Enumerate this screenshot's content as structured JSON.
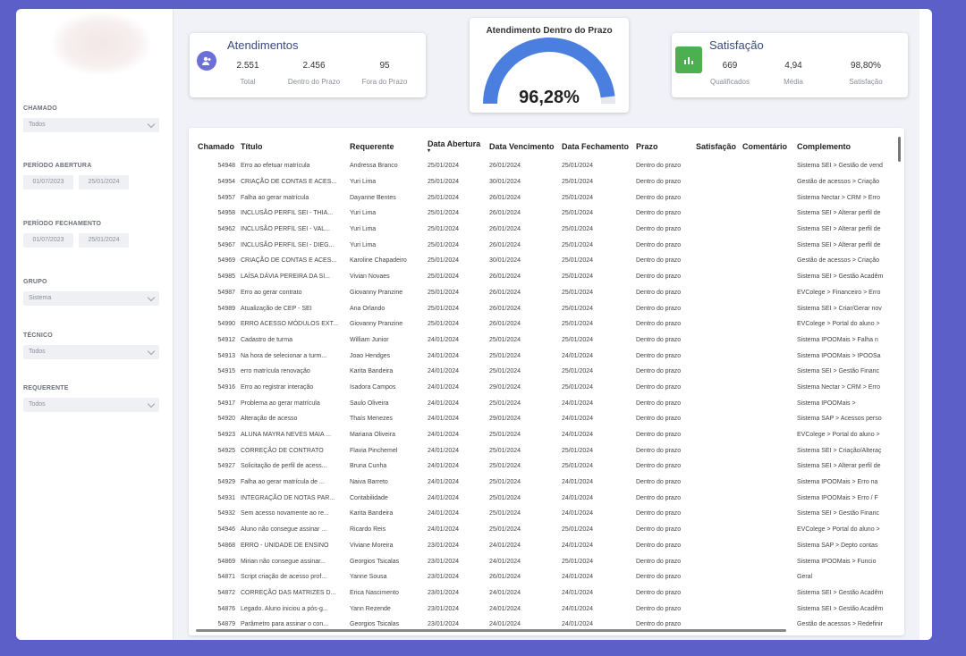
{
  "filters": {
    "chamado": {
      "label": "CHAMADO",
      "value": "Todos"
    },
    "periodo_abertura": {
      "label": "PERÍODO ABERTURA",
      "from": "01/07/2023",
      "to": "25/01/2024"
    },
    "periodo_fechamento": {
      "label": "PERÍODO FECHAMENTO",
      "from": "01/07/2023",
      "to": "25/01/2024"
    },
    "grupo": {
      "label": "GRUPO",
      "value": "Sistema"
    },
    "tecnico": {
      "label": "TÉCNICO",
      "value": "Todos"
    },
    "requerente": {
      "label": "REQUERENTE",
      "value": "Todos"
    }
  },
  "atendimentos": {
    "title": "Atendimentos",
    "icon": "users-icon",
    "color": "#6b6fd8",
    "stats": [
      {
        "value": "2.551",
        "label": "Total"
      },
      {
        "value": "2.456",
        "label": "Dentro do Prazo"
      },
      {
        "value": "95",
        "label": "Fora do Prazo"
      }
    ]
  },
  "gauge": {
    "title": "Atendimento Dentro do Prazo",
    "value_text": "96,28%",
    "value": 96.28,
    "color": "#4a7fe0"
  },
  "satisfacao": {
    "title": "Satisfação",
    "icon": "chart-icon",
    "color": "#4caf50",
    "stats": [
      {
        "value": "669",
        "label": "Qualificados"
      },
      {
        "value": "4,94",
        "label": "Média"
      },
      {
        "value": "98,80%",
        "label": "Satisfação"
      }
    ]
  },
  "table": {
    "columns": [
      "Chamado",
      "Título",
      "Requerente",
      "Data Abertura",
      "Data Vencimento",
      "Data Fechamento",
      "Prazo",
      "Satisfação",
      "Comentário",
      "Complemento"
    ],
    "rows": [
      [
        "54948",
        "Erro ao efetuar matrícula",
        "Andressa Branco",
        "25/01/2024",
        "26/01/2024",
        "25/01/2024",
        "Dentro do prazo",
        "",
        "",
        "Sistema SEI > Gestão de vend"
      ],
      [
        "54954",
        "CRIAÇÃO DE CONTAS E ACES...",
        "Yuri Lima",
        "25/01/2024",
        "30/01/2024",
        "25/01/2024",
        "Dentro do prazo",
        "",
        "",
        "Gestão de acessos > Criação"
      ],
      [
        "54957",
        "Falha ao gerar matrícula",
        "Dayanne Bentes",
        "25/01/2024",
        "26/01/2024",
        "25/01/2024",
        "Dentro do prazo",
        "",
        "",
        "Sistema Nectar > CRM > Erro"
      ],
      [
        "54958",
        "INCLUSÃO PERFIL SEI - THIA...",
        "Yuri Lima",
        "25/01/2024",
        "26/01/2024",
        "25/01/2024",
        "Dentro do prazo",
        "",
        "",
        "Sistema SEI > Alterar perfil de"
      ],
      [
        "54962",
        "INCLUSÃO PERFIL SEI - VAL...",
        "Yuri Lima",
        "25/01/2024",
        "26/01/2024",
        "25/01/2024",
        "Dentro do prazo",
        "",
        "",
        "Sistema SEI > Alterar perfil de"
      ],
      [
        "54967",
        "INCLUSÃO PERFIL SEI - DIEG...",
        "Yuri Lima",
        "25/01/2024",
        "26/01/2024",
        "25/01/2024",
        "Dentro do prazo",
        "",
        "",
        "Sistema SEI > Alterar perfil de"
      ],
      [
        "54969",
        "CRIAÇÃO DE CONTAS E ACES...",
        "Karoline Chapadeiro",
        "25/01/2024",
        "30/01/2024",
        "25/01/2024",
        "Dentro do prazo",
        "",
        "",
        "Gestão de acessos > Criação"
      ],
      [
        "54985",
        "LAÍSA DÁVIA PEREIRA DA SI...",
        "Vivian Novaes",
        "25/01/2024",
        "26/01/2024",
        "25/01/2024",
        "Dentro do prazo",
        "",
        "",
        "Sistema SEI > Gestão Acadêm"
      ],
      [
        "54987",
        "Erro ao gerar contrato",
        "Giovanny Pranzine",
        "25/01/2024",
        "26/01/2024",
        "25/01/2024",
        "Dentro do prazo",
        "",
        "",
        "EVColege > Financeiro > Erro"
      ],
      [
        "54989",
        "Atualização de CEP - SEI",
        "Ana Orlando",
        "25/01/2024",
        "26/01/2024",
        "25/01/2024",
        "Dentro do prazo",
        "",
        "",
        "Sistema SEI > Criar/Gerar nov"
      ],
      [
        "54990",
        "ERRO ACESSO MÓDULOS EXT...",
        "Giovanny Pranzine",
        "25/01/2024",
        "26/01/2024",
        "25/01/2024",
        "Dentro do prazo",
        "",
        "",
        "EVColege > Portal do aluno >"
      ],
      [
        "54912",
        "Cadastro de turma",
        "William Junior",
        "24/01/2024",
        "25/01/2024",
        "25/01/2024",
        "Dentro do prazo",
        "",
        "",
        "Sistema IPOOMais > Falha n"
      ],
      [
        "54913",
        "Na hora de selecionar a turm...",
        "Joao Hendges",
        "24/01/2024",
        "25/01/2024",
        "24/01/2024",
        "Dentro do prazo",
        "",
        "",
        "Sistema IPOOMais > IPOOSa"
      ],
      [
        "54915",
        "erro matrícula renovação",
        "Karita Bandeira",
        "24/01/2024",
        "25/01/2024",
        "25/01/2024",
        "Dentro do prazo",
        "",
        "",
        "Sistema SEI > Gestão Financ"
      ],
      [
        "54916",
        "Erro ao registrar interação",
        "Isadora Campos",
        "24/01/2024",
        "29/01/2024",
        "25/01/2024",
        "Dentro do prazo",
        "",
        "",
        "Sistema Nectar > CRM > Erro"
      ],
      [
        "54917",
        "Problema ao gerar matrícula",
        "Saulo Oliveira",
        "24/01/2024",
        "25/01/2024",
        "24/01/2024",
        "Dentro do prazo",
        "",
        "",
        "Sistema IPOOMais >"
      ],
      [
        "54920",
        "Alteração de acesso",
        "Thaís Menezes",
        "24/01/2024",
        "29/01/2024",
        "24/01/2024",
        "Dentro do prazo",
        "",
        "",
        "Sistema SAP > Acessos perso"
      ],
      [
        "54923",
        "ALUNA MAYRA NEVES MAIA ...",
        "Mariana Oliveira",
        "24/01/2024",
        "25/01/2024",
        "24/01/2024",
        "Dentro do prazo",
        "",
        "",
        "EVColege > Portal do aluno >"
      ],
      [
        "54925",
        "CORREÇÃO DE CONTRATO",
        "Flavia Pinchemel",
        "24/01/2024",
        "25/01/2024",
        "25/01/2024",
        "Dentro do prazo",
        "",
        "",
        "Sistema SEI > Criação/Alteraç"
      ],
      [
        "54927",
        "Solicitação de perfil de acess...",
        "Bruna Cunha",
        "24/01/2024",
        "25/01/2024",
        "25/01/2024",
        "Dentro do prazo",
        "",
        "",
        "Sistema SEI > Alterar perfil de"
      ],
      [
        "54929",
        "Falha ao gerar matrícula de ...",
        "Naiva Barreto",
        "24/01/2024",
        "25/01/2024",
        "24/01/2024",
        "Dentro do prazo",
        "",
        "",
        "Sistema IPOOMais > Erro na"
      ],
      [
        "54931",
        "INTEGRAÇÃO DE NOTAS PAR...",
        "Contabilidade",
        "24/01/2024",
        "25/01/2024",
        "24/01/2024",
        "Dentro do prazo",
        "",
        "",
        "Sistema IPOOMais > Erro / F"
      ],
      [
        "54932",
        "Sem acesso novamente ao re...",
        "Karita Bandeira",
        "24/01/2024",
        "25/01/2024",
        "24/01/2024",
        "Dentro do prazo",
        "",
        "",
        "Sistema SEI > Gestão Financ"
      ],
      [
        "54946",
        "Aluno não consegue assinar ...",
        "Ricardo Reis",
        "24/01/2024",
        "25/01/2024",
        "25/01/2024",
        "Dentro do prazo",
        "",
        "",
        "EVColege > Portal do aluno >"
      ],
      [
        "54868",
        "ERRO - UNIDADE DE ENSINO",
        "Viviane Moreira",
        "23/01/2024",
        "24/01/2024",
        "24/01/2024",
        "Dentro do prazo",
        "",
        "",
        "Sistema SAP > Depto contas"
      ],
      [
        "54869",
        "Mirian não consegue assinar...",
        "Georgios Tsicalas",
        "23/01/2024",
        "24/01/2024",
        "25/01/2024",
        "Dentro do prazo",
        "",
        "",
        "Sistema IPOOMais > Funcio"
      ],
      [
        "54871",
        "Script criação de acesso prof...",
        "Yanne Sousa",
        "23/01/2024",
        "26/01/2024",
        "24/01/2024",
        "Dentro do prazo",
        "",
        "",
        "Geral"
      ],
      [
        "54872",
        "CORREÇÃO DAS MATRIZES D...",
        "Erica Nascimento",
        "23/01/2024",
        "24/01/2024",
        "24/01/2024",
        "Dentro do prazo",
        "",
        "",
        "Sistema SEI > Gestão Acadêm"
      ],
      [
        "54876",
        "Legado. Aluno iniciou a pós-g...",
        "Yann Rezende",
        "23/01/2024",
        "24/01/2024",
        "24/01/2024",
        "Dentro do prazo",
        "",
        "",
        "Sistema SEI > Gestão Acadêm"
      ],
      [
        "54879",
        "Parâmetro para assinar o con...",
        "Georgios Tsicalas",
        "23/01/2024",
        "24/01/2024",
        "24/01/2024",
        "Dentro do prazo",
        "",
        "",
        "Gestão de acessos > Redefinir"
      ]
    ]
  }
}
